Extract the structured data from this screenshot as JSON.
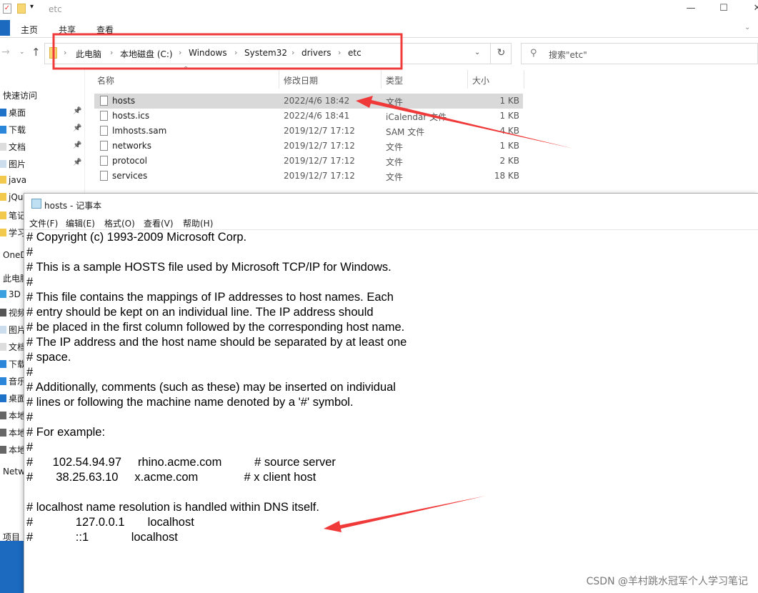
{
  "window": {
    "title": "etc",
    "minimize": "—",
    "maximize": "☐",
    "close": "✕"
  },
  "ribbon": {
    "tabs": [
      "主页",
      "共享",
      "查看"
    ]
  },
  "address": {
    "crumbs": [
      "此电脑",
      "本地磁盘 (C:)",
      "Windows",
      "System32",
      "drivers",
      "etc"
    ]
  },
  "search": {
    "placeholder": "搜索\"etc\""
  },
  "columns": {
    "name": "名称",
    "date": "修改日期",
    "type": "类型",
    "size": "大小"
  },
  "files": [
    {
      "name": "hosts",
      "date": "2022/4/6 18:42",
      "type": "文件",
      "size": "1 KB",
      "selected": true
    },
    {
      "name": "hosts.ics",
      "date": "2022/4/6 18:41",
      "type": "iCalendar 文件",
      "size": "1 KB"
    },
    {
      "name": "lmhosts.sam",
      "date": "2019/12/7 17:12",
      "type": "SAM 文件",
      "size": "4 KB"
    },
    {
      "name": "networks",
      "date": "2019/12/7 17:12",
      "type": "文件",
      "size": "1 KB"
    },
    {
      "name": "protocol",
      "date": "2019/12/7 17:12",
      "type": "文件",
      "size": "2 KB"
    },
    {
      "name": "services",
      "date": "2019/12/7 17:12",
      "type": "文件",
      "size": "18 KB"
    }
  ],
  "sidebar": [
    {
      "label": "快速访问",
      "icon": "",
      "pinned": false
    },
    {
      "label": "桌面",
      "icon": "desktop",
      "pinned": true
    },
    {
      "label": "下载",
      "icon": "download",
      "pinned": true
    },
    {
      "label": "文档",
      "icon": "document",
      "pinned": true
    },
    {
      "label": "图片",
      "icon": "picture",
      "pinned": true
    },
    {
      "label": "java",
      "icon": "folder"
    },
    {
      "label": "jQuery",
      "icon": "folder"
    },
    {
      "label": "笔记",
      "icon": "folder"
    },
    {
      "label": "学习",
      "icon": "folder"
    },
    {
      "label": "OneD",
      "icon": ""
    },
    {
      "label": "此电脑",
      "icon": ""
    },
    {
      "label": "3D",
      "icon": "3d"
    },
    {
      "label": "视频",
      "icon": "video"
    },
    {
      "label": "图片",
      "icon": "picture"
    },
    {
      "label": "文档",
      "icon": "document"
    },
    {
      "label": "下载",
      "icon": "download"
    },
    {
      "label": "音乐",
      "icon": "music"
    },
    {
      "label": "桌面",
      "icon": "desktop"
    },
    {
      "label": "本地",
      "icon": "drive"
    },
    {
      "label": "本地",
      "icon": "drive"
    },
    {
      "label": "本地",
      "icon": "drive"
    },
    {
      "label": "Netw",
      "icon": ""
    },
    {
      "label": "项目",
      "icon": ""
    }
  ],
  "notepad": {
    "title": "hosts - 记事本",
    "menu": [
      "文件(F)",
      "编辑(E)",
      "格式(O)",
      "查看(V)",
      "帮助(H)"
    ],
    "lines": [
      "# Copyright (c) 1993-2009 Microsoft Corp.",
      "#",
      "# This is a sample HOSTS file used by Microsoft TCP/IP for Windows.",
      "#",
      "# This file contains the mappings of IP addresses to host names. Each",
      "# entry should be kept on an individual line. The IP address should",
      "# be placed in the first column followed by the corresponding host name.",
      "# The IP address and the host name should be separated by at least one",
      "# space.",
      "#",
      "# Additionally, comments (such as these) may be inserted on individual",
      "# lines or following the machine name denoted by a '#' symbol.",
      "#",
      "# For example:",
      "#",
      "#      102.54.94.97     rhino.acme.com          # source server",
      "#       38.25.63.10     x.acme.com              # x client host",
      "",
      "# localhost name resolution is handled within DNS itself.",
      "#             127.0.0.1       localhost",
      "#             ::1             localhost"
    ]
  },
  "annotation_color": "#f03a3a",
  "watermark": "CSDN @羊村跳水冠军个人学习笔记"
}
